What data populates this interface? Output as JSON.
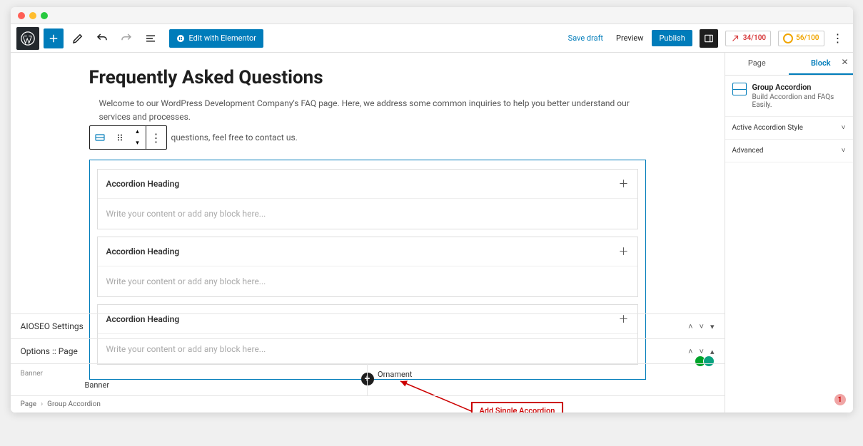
{
  "topbar": {
    "elementor_label": "Edit with Elementor",
    "save_draft": "Save draft",
    "preview": "Preview",
    "publish": "Publish",
    "score1": "34/100",
    "score2": "56/100"
  },
  "page": {
    "title": "Frequently Asked Questions",
    "intro_line1": "Welcome to our WordPress Development Company's FAQ page. Here, we address some common inquiries to help you better understand our services and processes.",
    "intro_line2_tail": "questions, feel free to contact us."
  },
  "accordion": {
    "items": [
      {
        "heading": "Accordion Heading",
        "placeholder": "Write your content or add any block here..."
      },
      {
        "heading": "Accordion Heading",
        "placeholder": "Write your content or add any block here..."
      },
      {
        "heading": "Accordion Heading",
        "placeholder": "Write your content or add any block here..."
      }
    ],
    "annotation": "Add Single Accordion"
  },
  "meta_panels": {
    "aioseo": "AIOSEO Settings",
    "options": "Options :: Page",
    "col_a_label": "Banner",
    "col_a_value": "Banner",
    "col_b_value": "Ornament"
  },
  "breadcrumb": {
    "a": "Page",
    "b": "Group Accordion"
  },
  "sidebar": {
    "tab_page": "Page",
    "tab_block": "Block",
    "block_title": "Group Accordion",
    "block_desc": "Build Accordion and FAQs Easily.",
    "panel1": "Active Accordion Style",
    "panel2": "Advanced",
    "notif": "1"
  }
}
